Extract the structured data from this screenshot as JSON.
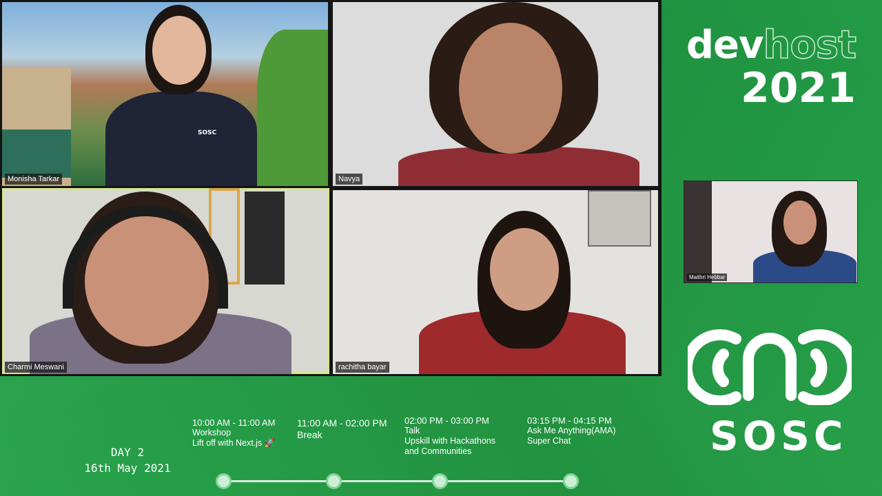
{
  "participants": [
    {
      "name": "Monisha Tarkar"
    },
    {
      "name": "Navya"
    },
    {
      "name": "Charmi Meswani"
    },
    {
      "name": "rachitha bayar"
    },
    {
      "name": "Maithri Hebbar"
    }
  ],
  "shirt_logo_text": "SOSC",
  "brand": {
    "dev": "dev",
    "host": "host",
    "year": "2021"
  },
  "org": {
    "name": "SOSC"
  },
  "schedule": {
    "day": "DAY 2",
    "date": "16th May 2021",
    "events": [
      {
        "time": "10:00 AM - 11:00 AM",
        "title": "Workshop",
        "subtitle": "Lift off with Next.js 🚀"
      },
      {
        "time": "11:00 AM - 02:00 PM",
        "title": "Break"
      },
      {
        "time": "02:00 PM - 03:00 PM",
        "title": "Talk",
        "subtitle": "Upskill with Hackathons",
        "subtitle2": "and Communities"
      },
      {
        "time": "03:15 PM - 04:15 PM",
        "title": "Ask Me Anything(AMA)",
        "subtitle": "Super Chat"
      }
    ]
  },
  "colors": {
    "background": "#1f9a3e",
    "active_speaker_border": "#d6e68c",
    "timeline": "#ccefd6"
  }
}
